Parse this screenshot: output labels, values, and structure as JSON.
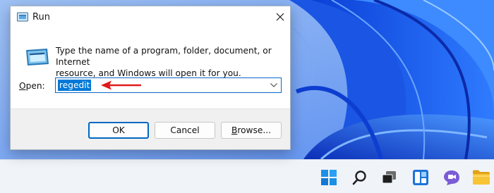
{
  "colors": {
    "accent": "#0067c0",
    "selection": "#0078d7",
    "annotation_arrow": "#e01b1b",
    "wallpaper": "#1456e0"
  },
  "dialog": {
    "title": "Run",
    "title_icon": "run-icon",
    "close_icon": "close-icon",
    "program_icon": "run-program-icon",
    "description_line1": "Type the name of a program, folder, document, or Internet",
    "description_line2": "resource, and Windows will open it for you.",
    "open_label_first": "O",
    "open_label_rest": "pen:",
    "open_value": "regedit",
    "dropdown_icon": "chevron-down-icon",
    "annotation": "red-arrow-icon",
    "buttons": {
      "ok": "OK",
      "cancel": "Cancel",
      "browse_first": "B",
      "browse_rest": "rowse..."
    }
  },
  "taskbar": {
    "items": [
      "start-icon",
      "search-icon",
      "task-view-icon",
      "widgets-icon",
      "chat-icon",
      "file-explorer-icon"
    ]
  }
}
